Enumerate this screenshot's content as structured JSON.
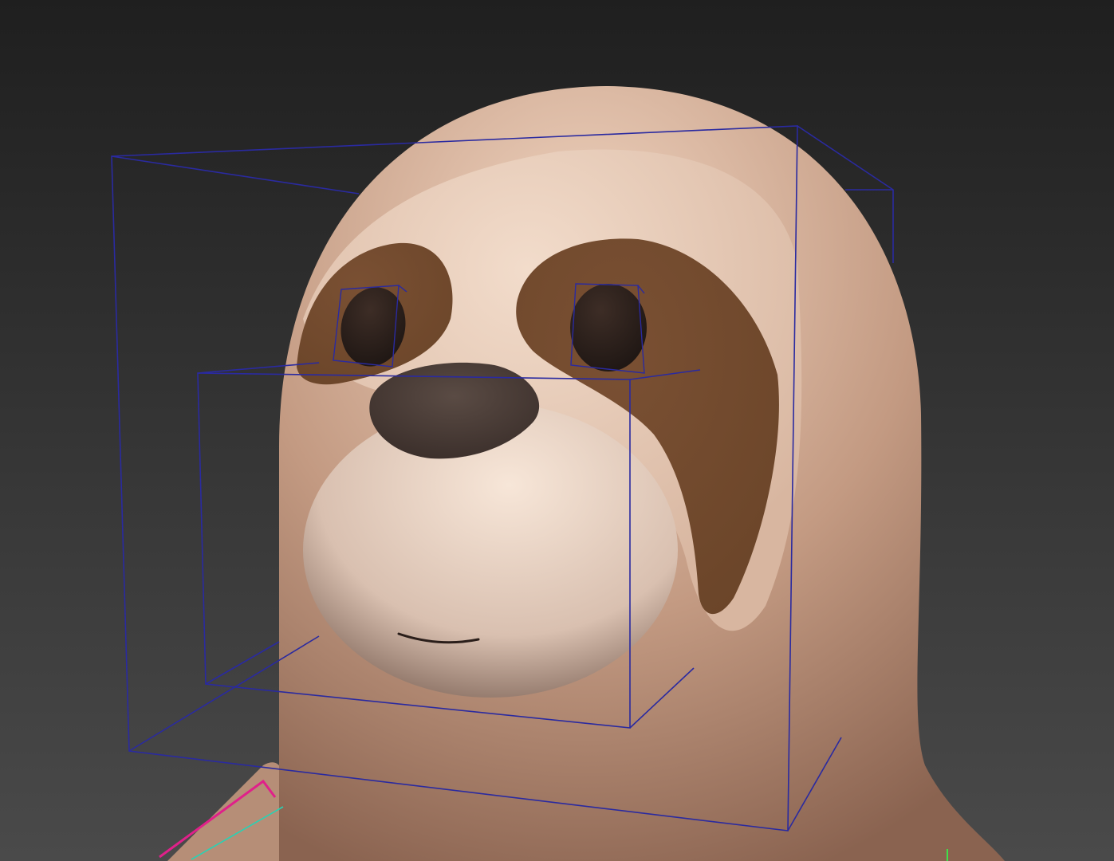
{
  "viewport": {
    "colors": {
      "background_top": "#1f1f1f",
      "background_bottom": "#4a4a4a",
      "body_light": "#f0d4c0",
      "body_mid": "#c39a82",
      "body_dark": "#8a6350",
      "eye_mask": "#6b4529",
      "face_band": "#f2dccb",
      "muzzle_light": "#f7e6d8",
      "muzzle_dark": "#6e5448",
      "nose": "#3a2e2a",
      "eye": "#1e1613",
      "selection_box": "#2a2aa0",
      "gizmo_x": "#e0208a",
      "gizmo_y": "#28d2b4",
      "gizmo_z": "#3fe04a"
    }
  }
}
